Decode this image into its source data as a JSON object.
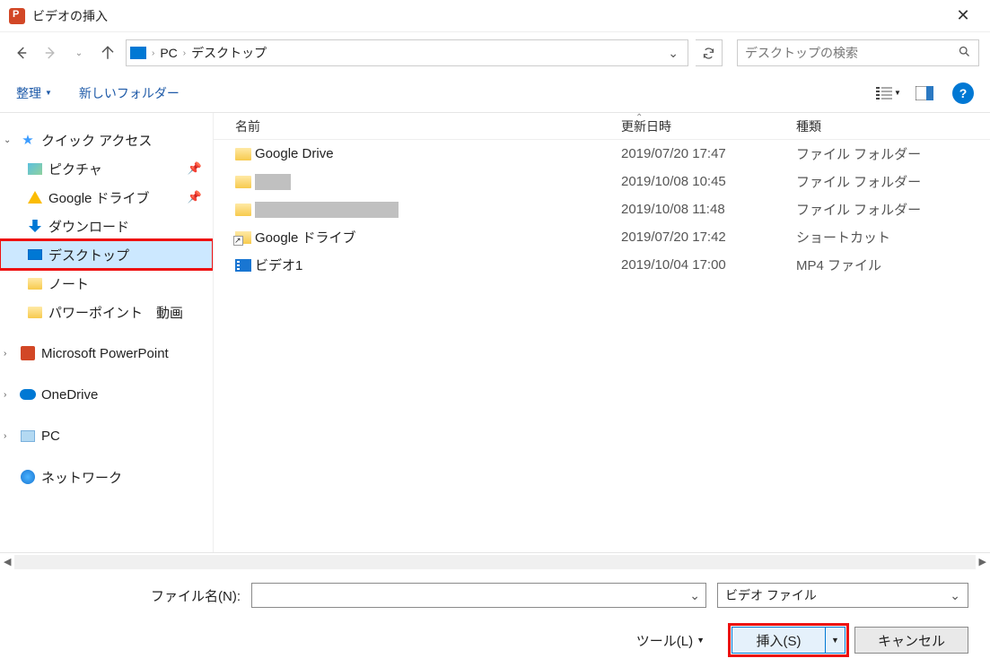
{
  "window": {
    "title": "ビデオの挿入"
  },
  "breadcrumb": {
    "root": "PC",
    "folder": "デスクトップ"
  },
  "search": {
    "placeholder": "デスクトップの検索"
  },
  "toolbar": {
    "organize": "整理",
    "new_folder": "新しいフォルダー"
  },
  "columns": {
    "name": "名前",
    "date": "更新日時",
    "type": "種類"
  },
  "tree": {
    "quick_access": "クイック アクセス",
    "pictures": "ピクチャ",
    "gdrive": "Google ドライブ",
    "downloads": "ダウンロード",
    "desktop": "デスクトップ",
    "notes": "ノート",
    "ppt_video": "パワーポイント　動画",
    "ms_ppt": "Microsoft PowerPoint",
    "onedrive": "OneDrive",
    "pc": "PC",
    "network": "ネットワーク"
  },
  "files": [
    {
      "name": "Google Drive",
      "date": "2019/07/20 17:47",
      "type": "ファイル フォルダー",
      "icon": "folder"
    },
    {
      "name": "",
      "date": "2019/10/08 10:45",
      "type": "ファイル フォルダー",
      "icon": "folder",
      "redacted": "w1"
    },
    {
      "name": "",
      "date": "2019/10/08 11:48",
      "type": "ファイル フォルダー",
      "icon": "folder",
      "redacted": "w2"
    },
    {
      "name": "Google ドライブ",
      "date": "2019/07/20 17:42",
      "type": "ショートカット",
      "icon": "shortcut"
    },
    {
      "name": "ビデオ1",
      "date": "2019/10/04 17:00",
      "type": "MP4 ファイル",
      "icon": "video"
    }
  ],
  "footer": {
    "filename_label": "ファイル名(N):",
    "filter": "ビデオ ファイル",
    "tools": "ツール(L)",
    "insert": "挿入(S)",
    "cancel": "キャンセル"
  }
}
